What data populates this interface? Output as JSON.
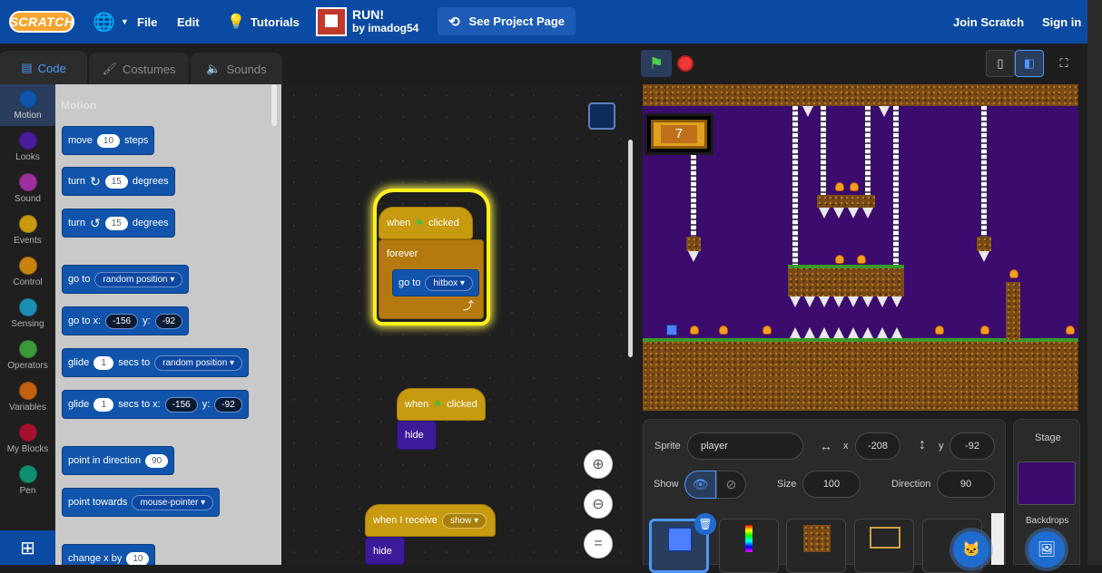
{
  "menu": {
    "logo": "SCRATCH",
    "file": "File",
    "edit": "Edit",
    "tutorials": "Tutorials",
    "project_title": "RUN!",
    "project_author": "by imadog54",
    "see_project": "See Project Page",
    "join": "Join Scratch",
    "signin": "Sign in"
  },
  "tabs": [
    "Code",
    "Costumes",
    "Sounds"
  ],
  "categories": [
    {
      "label": "Motion",
      "color": "#1154ac"
    },
    {
      "label": "Looks",
      "color": "#4a1b9a"
    },
    {
      "label": "Sound",
      "color": "#a12e9e"
    },
    {
      "label": "Events",
      "color": "#c79a10"
    },
    {
      "label": "Control",
      "color": "#c7820f"
    },
    {
      "label": "Sensing",
      "color": "#1a8fb3"
    },
    {
      "label": "Operators",
      "color": "#3a9a3a"
    },
    {
      "label": "Variables",
      "color": "#c3600e"
    },
    {
      "label": "My Blocks",
      "color": "#a5112c"
    },
    {
      "label": "Pen",
      "color": "#0f8f6f"
    }
  ],
  "palette": {
    "title": "Motion",
    "move": {
      "a": "move",
      "n": "10",
      "b": "steps"
    },
    "turn_r": {
      "a": "turn",
      "n": "15",
      "b": "degrees"
    },
    "turn_l": {
      "a": "turn",
      "n": "15",
      "b": "degrees"
    },
    "goto": {
      "a": "go to",
      "dd": "random position"
    },
    "gotoxy": {
      "a": "go to x:",
      "x": "-156",
      "b": "y:",
      "y": "-92"
    },
    "glide1": {
      "a": "glide",
      "n": "1",
      "b": "secs to",
      "dd": "random position"
    },
    "glide2": {
      "a": "glide",
      "n": "1",
      "b": "secs to x:",
      "x": "-156",
      "c": "y:",
      "y": "-92"
    },
    "point": {
      "a": "point in direction",
      "n": "90"
    },
    "towards": {
      "a": "point towards",
      "dd": "mouse-pointer"
    },
    "changex": {
      "a": "change x by",
      "n": "10"
    }
  },
  "scripts": {
    "s1": {
      "when": "when",
      "clicked": "clicked",
      "forever": "forever",
      "goto": "go to",
      "target": "hitbox"
    },
    "s2": {
      "when": "when",
      "clicked": "clicked",
      "hide": "hide"
    },
    "s3": {
      "when": "when I receive",
      "msg": "show",
      "hide": "hide"
    }
  },
  "stage": {
    "counter": "7"
  },
  "sprite_info": {
    "sprite_label": "Sprite",
    "sprite_name": "player",
    "x_label": "x",
    "x": "-208",
    "y_label": "y",
    "y": "-92",
    "show_label": "Show",
    "size_label": "Size",
    "size": "100",
    "direction_label": "Direction",
    "direction": "90"
  },
  "stage_panel": {
    "title": "Stage",
    "backdrops": "Backdrops"
  }
}
